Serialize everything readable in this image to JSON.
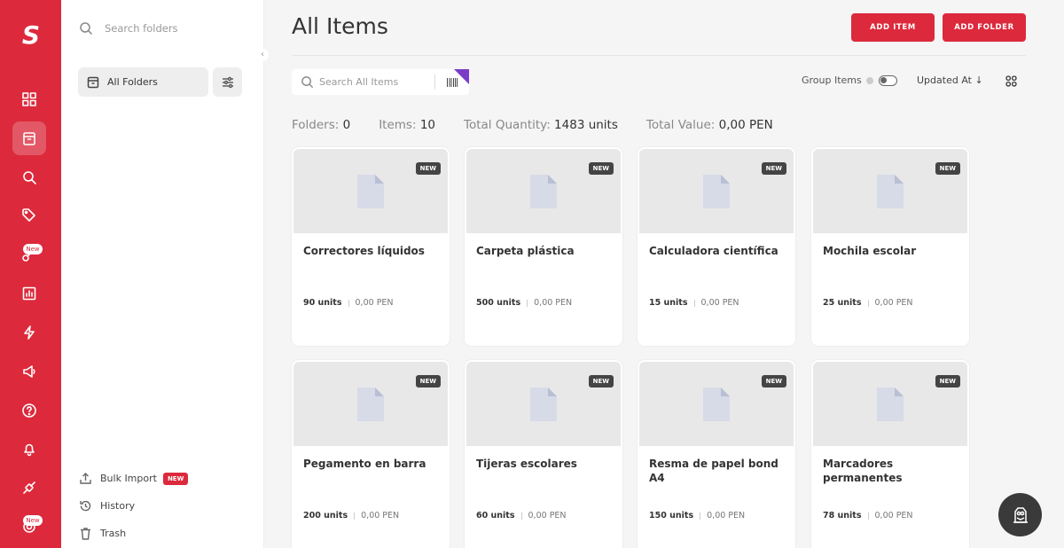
{
  "brand": {
    "logo_letter": "S",
    "accent": "#dc2a3c"
  },
  "rail": {
    "icons": [
      "dashboard-icon",
      "items-icon",
      "search-icon",
      "tags-icon",
      "workflows-icon",
      "reports-icon",
      "automation-icon",
      "announcements-icon",
      "help-icon",
      "notifications-icon",
      "integrations-icon",
      "settings-icon"
    ],
    "badges": [
      "New",
      "New"
    ]
  },
  "folders_panel": {
    "search_placeholder": "Search folders",
    "all_folders_label": "All Folders",
    "bulk_import_label": "Bulk Import",
    "bulk_import_badge": "NEW",
    "history_label": "History",
    "trash_label": "Trash"
  },
  "header": {
    "title": "All Items",
    "add_item_label": "ADD ITEM",
    "add_folder_label": "ADD FOLDER"
  },
  "toolbar": {
    "search_placeholder": "Search All Items",
    "group_items_label": "Group Items",
    "sort_label": "Updated At",
    "sort_arrow": "↓"
  },
  "stats": {
    "folders_label": "Folders:",
    "folders_value": "0",
    "items_label": "Items:",
    "items_value": "10",
    "qty_label": "Total Quantity:",
    "qty_value": "1483 units",
    "value_label": "Total Value:",
    "value_value": "0,00 PEN"
  },
  "cards": [
    {
      "badge": "NEW",
      "name": "Correctores líquidos",
      "units": "90 units",
      "value": "0,00 PEN"
    },
    {
      "badge": "NEW",
      "name": "Carpeta plástica",
      "units": "500 units",
      "value": "0,00 PEN"
    },
    {
      "badge": "NEW",
      "name": "Calculadora científica",
      "units": "15 units",
      "value": "0,00 PEN"
    },
    {
      "badge": "NEW",
      "name": "Mochila escolar",
      "units": "25 units",
      "value": "0,00 PEN"
    },
    {
      "badge": "NEW",
      "name": "Pegamento en barra",
      "units": "200 units",
      "value": "0,00 PEN"
    },
    {
      "badge": "NEW",
      "name": "Tijeras escolares",
      "units": "60 units",
      "value": "0,00 PEN"
    },
    {
      "badge": "NEW",
      "name": "Resma de papel bond A4",
      "units": "150 units",
      "value": "0,00 PEN"
    },
    {
      "badge": "NEW",
      "name": "Marcadores permanentes",
      "units": "78 units",
      "value": "0,00 PEN"
    }
  ]
}
